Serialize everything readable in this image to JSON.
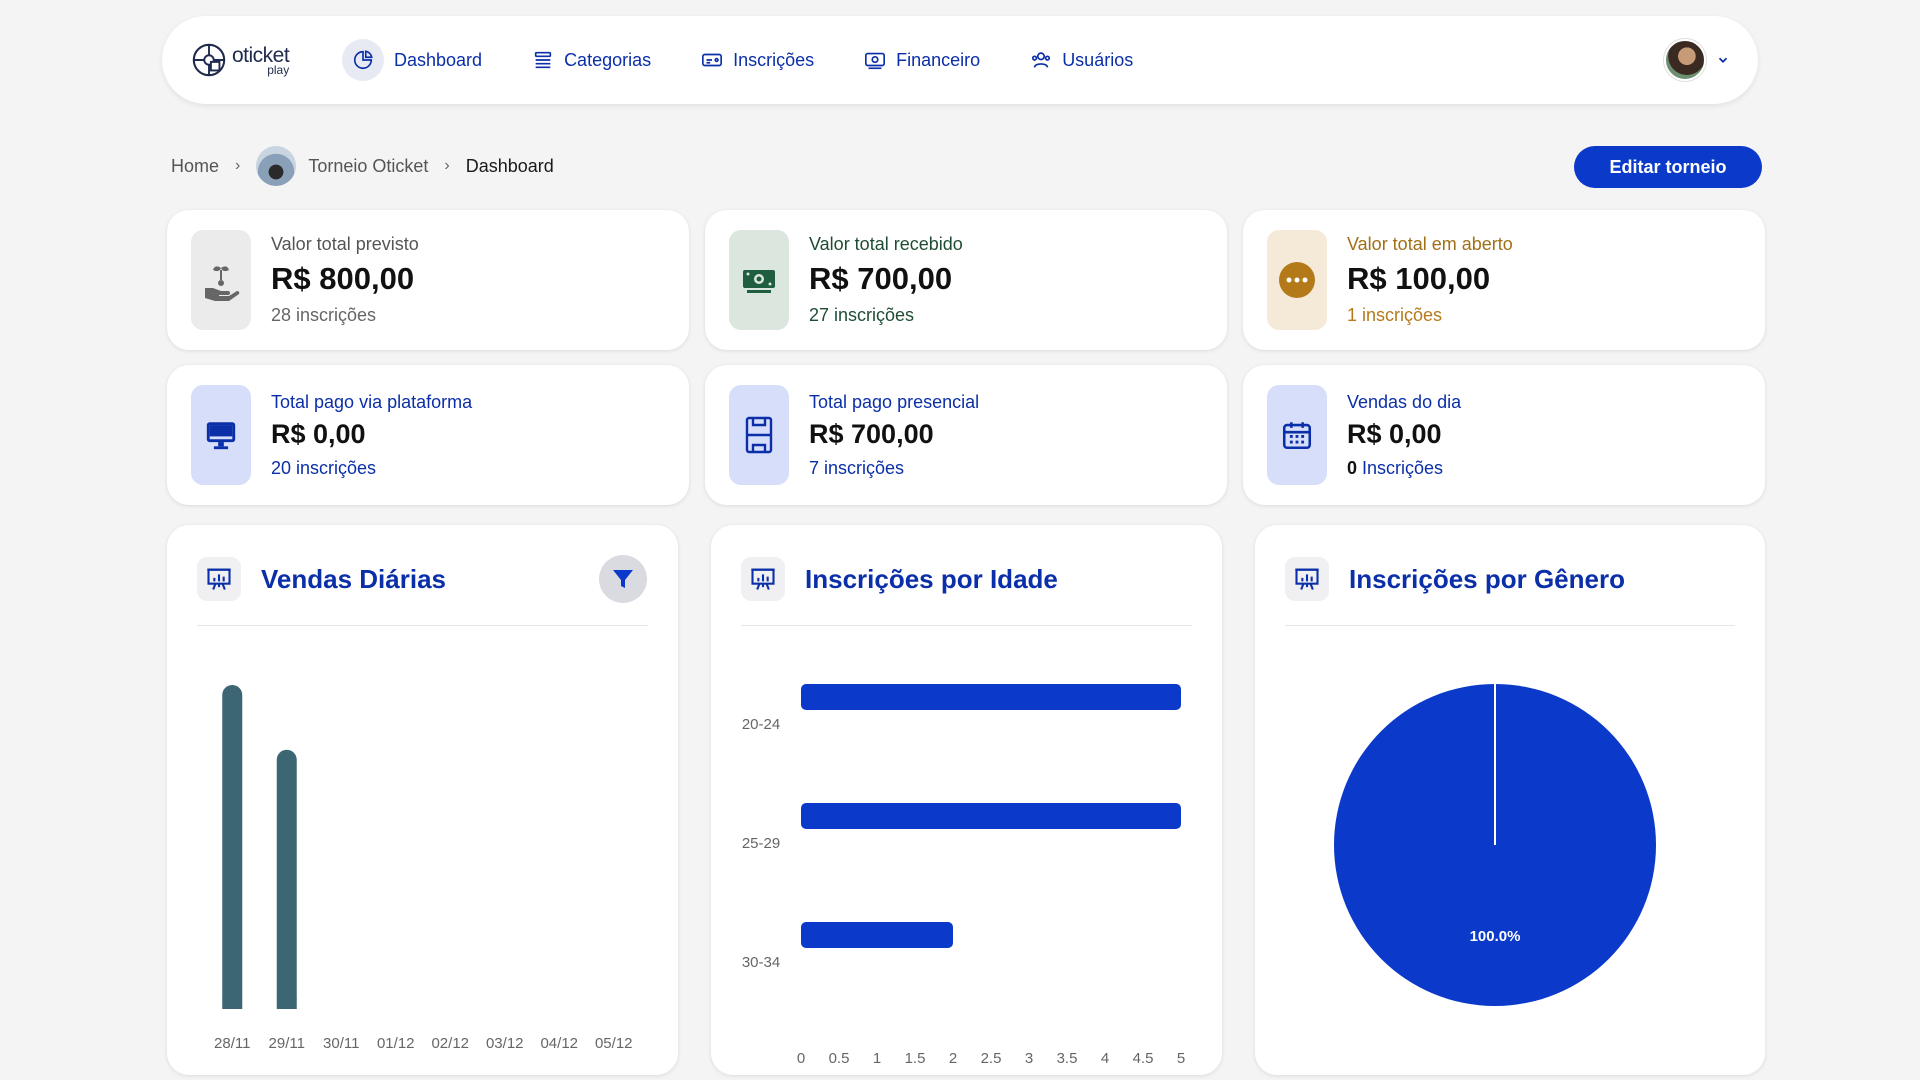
{
  "nav": {
    "logo": {
      "word1": "oticket",
      "word2": "play"
    },
    "items": [
      {
        "label": "Dashboard",
        "icon": "pie-chart-icon"
      },
      {
        "label": "Categorias",
        "icon": "list-icon"
      },
      {
        "label": "Inscrições",
        "icon": "ticket-icon"
      },
      {
        "label": "Financeiro",
        "icon": "money-icon"
      },
      {
        "label": "Usuários",
        "icon": "users-icon"
      }
    ],
    "profile_icon": "chevron-down-icon"
  },
  "breadcrumb": {
    "home": "Home",
    "tournament": "Torneio Oticket",
    "current": "Dashboard"
  },
  "edit_button": "Editar torneio",
  "stats": [
    {
      "label": "Valor total previsto",
      "value": "R$ 800,00",
      "sub": "28 inscrições",
      "icon": "hand-coin-icon",
      "bg": "#ebebec",
      "label_color": "#555555",
      "sub_color": "#666666"
    },
    {
      "label": "Valor total recebido",
      "value": "R$ 700,00",
      "sub": "27 inscrições",
      "icon": "banknote-icon",
      "bg": "#dbe6df",
      "label_color": "#1f4d33",
      "sub_color": "#1f4d33"
    },
    {
      "label": "Valor total em aberto",
      "value": "R$ 100,00",
      "sub": "1 inscrições",
      "icon": "dots-icon",
      "bg": "#f5ead8",
      "label_color": "#a26f16",
      "sub_color": "#b47a1a"
    },
    {
      "label": "Total pago via plataforma",
      "value": "R$ 0,00",
      "sub": "20 inscrições",
      "icon": "monitor-icon",
      "bg": "#d6defa",
      "label_color": "#0b2fa8",
      "sub_color": "#0b2fa8"
    },
    {
      "label": "Total pago presencial",
      "value": "R$ 700,00",
      "sub": "7 inscrições",
      "icon": "court-icon",
      "bg": "#d6defa",
      "label_color": "#0b2fa8",
      "sub_color": "#0b2fa8"
    },
    {
      "label": "Vendas do dia",
      "value": "R$ 0,00",
      "sub_count": "0",
      "sub": " Inscrições",
      "icon": "calendar-icon",
      "bg": "#d6defa",
      "label_color": "#0b2fa8",
      "sub_color": "#0b2fa8"
    }
  ],
  "charts": {
    "daily": {
      "title": "Vendas Diárias",
      "icon": "presentation-chart-icon",
      "filter_icon": "filter-icon"
    },
    "age": {
      "title": "Inscrições por Idade",
      "icon": "presentation-chart-icon"
    },
    "gender": {
      "title": "Inscrições por Gênero",
      "icon": "presentation-chart-icon"
    }
  },
  "chart_data": [
    {
      "type": "bar",
      "title": "Vendas Diárias",
      "categories": [
        "28/11",
        "29/11",
        "30/11",
        "01/12",
        "02/12",
        "03/12",
        "04/12",
        "05/12"
      ],
      "values": [
        1.0,
        0.8,
        0,
        0,
        0,
        0,
        0,
        0
      ],
      "color": "#3d6675",
      "grid": false
    },
    {
      "type": "bar",
      "orientation": "horizontal",
      "title": "Inscrições por Idade",
      "categories": [
        "20-24",
        "25-29",
        "30-34"
      ],
      "values": [
        5,
        5,
        2
      ],
      "xlim": [
        0,
        5
      ],
      "xticks": [
        "0",
        "0.5",
        "1",
        "1.5",
        "2",
        "2.5",
        "3",
        "3.5",
        "4",
        "4.5",
        "5"
      ],
      "color": "#0b39c9",
      "grid": false
    },
    {
      "type": "pie",
      "title": "Inscrições por Gênero",
      "slices": [
        {
          "value": 100.0,
          "label": "100.0%"
        }
      ],
      "color": "#0b39c9"
    }
  ]
}
